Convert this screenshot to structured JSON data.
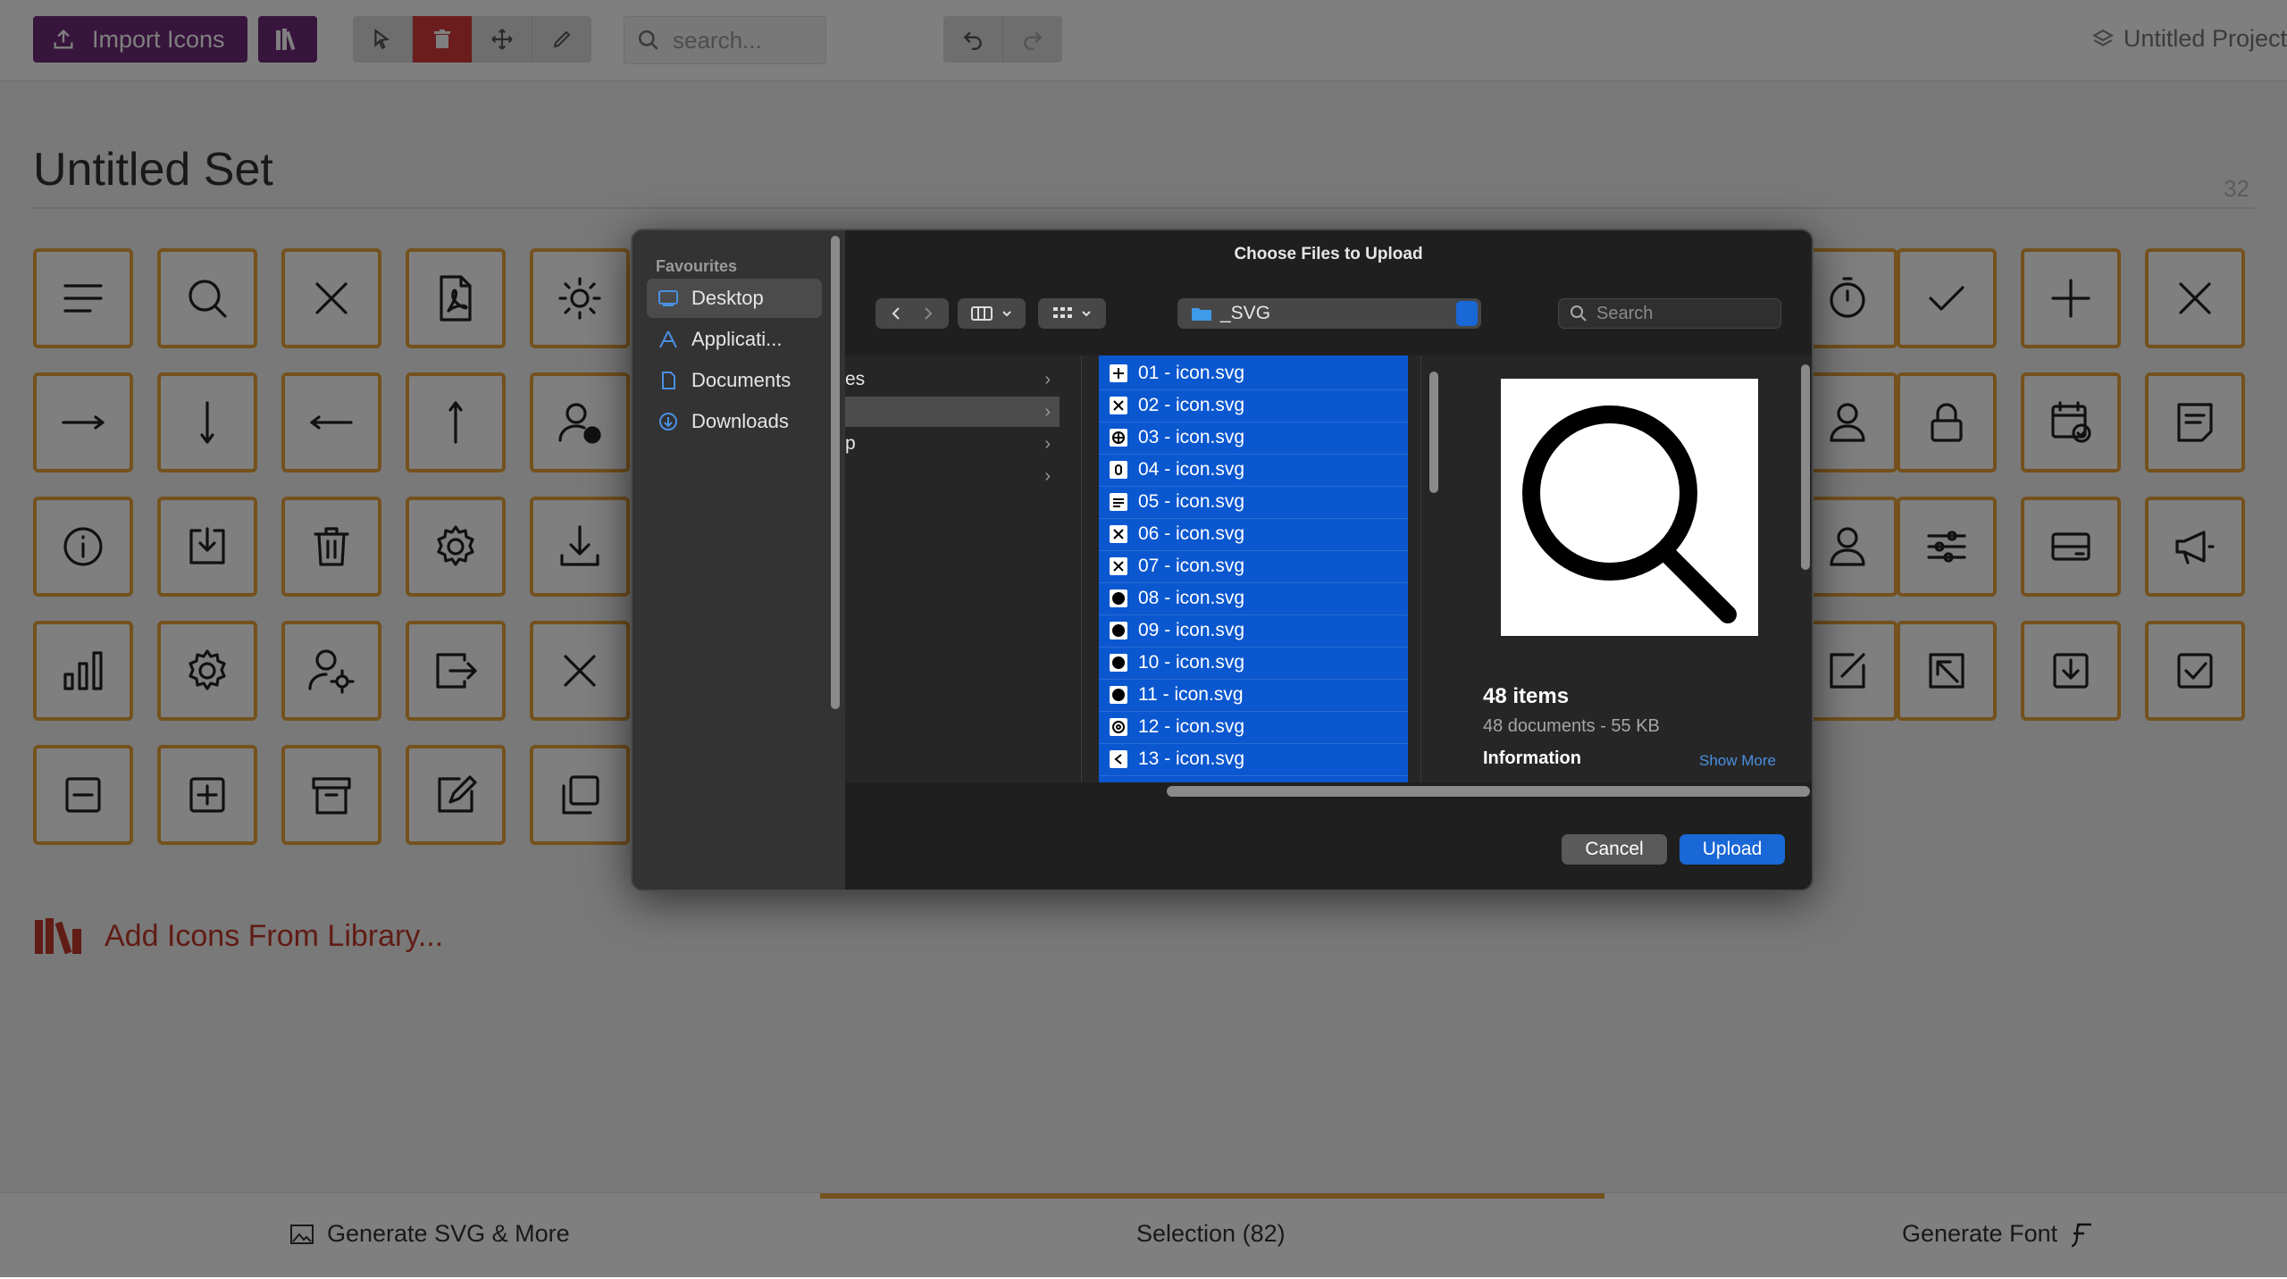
{
  "toolbar": {
    "import_label": "Import Icons",
    "search_placeholder": "search...",
    "project_name": "Untitled Project"
  },
  "set": {
    "title": "Untitled Set",
    "count": "32"
  },
  "add_library_label": "Add Icons From Library...",
  "bottom": {
    "generate_svg": "Generate SVG & More",
    "selection": "Selection (82)",
    "generate_font": "Generate Font"
  },
  "dialog": {
    "title": "Choose Files to Upload",
    "sidebar_heading": "Favourites",
    "sidebar_items": [
      "Desktop",
      "Applicati...",
      "Documents",
      "Downloads"
    ],
    "path": "_SVG",
    "search_placeholder": "Search",
    "column1": [
      "es",
      "",
      "p",
      ""
    ],
    "files": [
      "01 - icon.svg",
      "02 - icon.svg",
      "03 - icon.svg",
      "04 - icon.svg",
      "05 - icon.svg",
      "06 - icon.svg",
      "07 - icon.svg",
      "08 - icon.svg",
      "09 - icon.svg",
      "10 - icon.svg",
      "11 - icon.svg",
      "12 - icon.svg",
      "13 - icon.svg"
    ],
    "preview_items": "48 items",
    "preview_docs": "48 documents - 55 KB",
    "info_label": "Information",
    "show_more": "Show More",
    "cancel": "Cancel",
    "upload": "Upload"
  },
  "colors": {
    "accent_purple": "#6f2a78",
    "tile_border": "#e8a23a",
    "danger": "#d63a3a",
    "selection_blue": "#0b57d0",
    "link_red": "#c0392b"
  }
}
